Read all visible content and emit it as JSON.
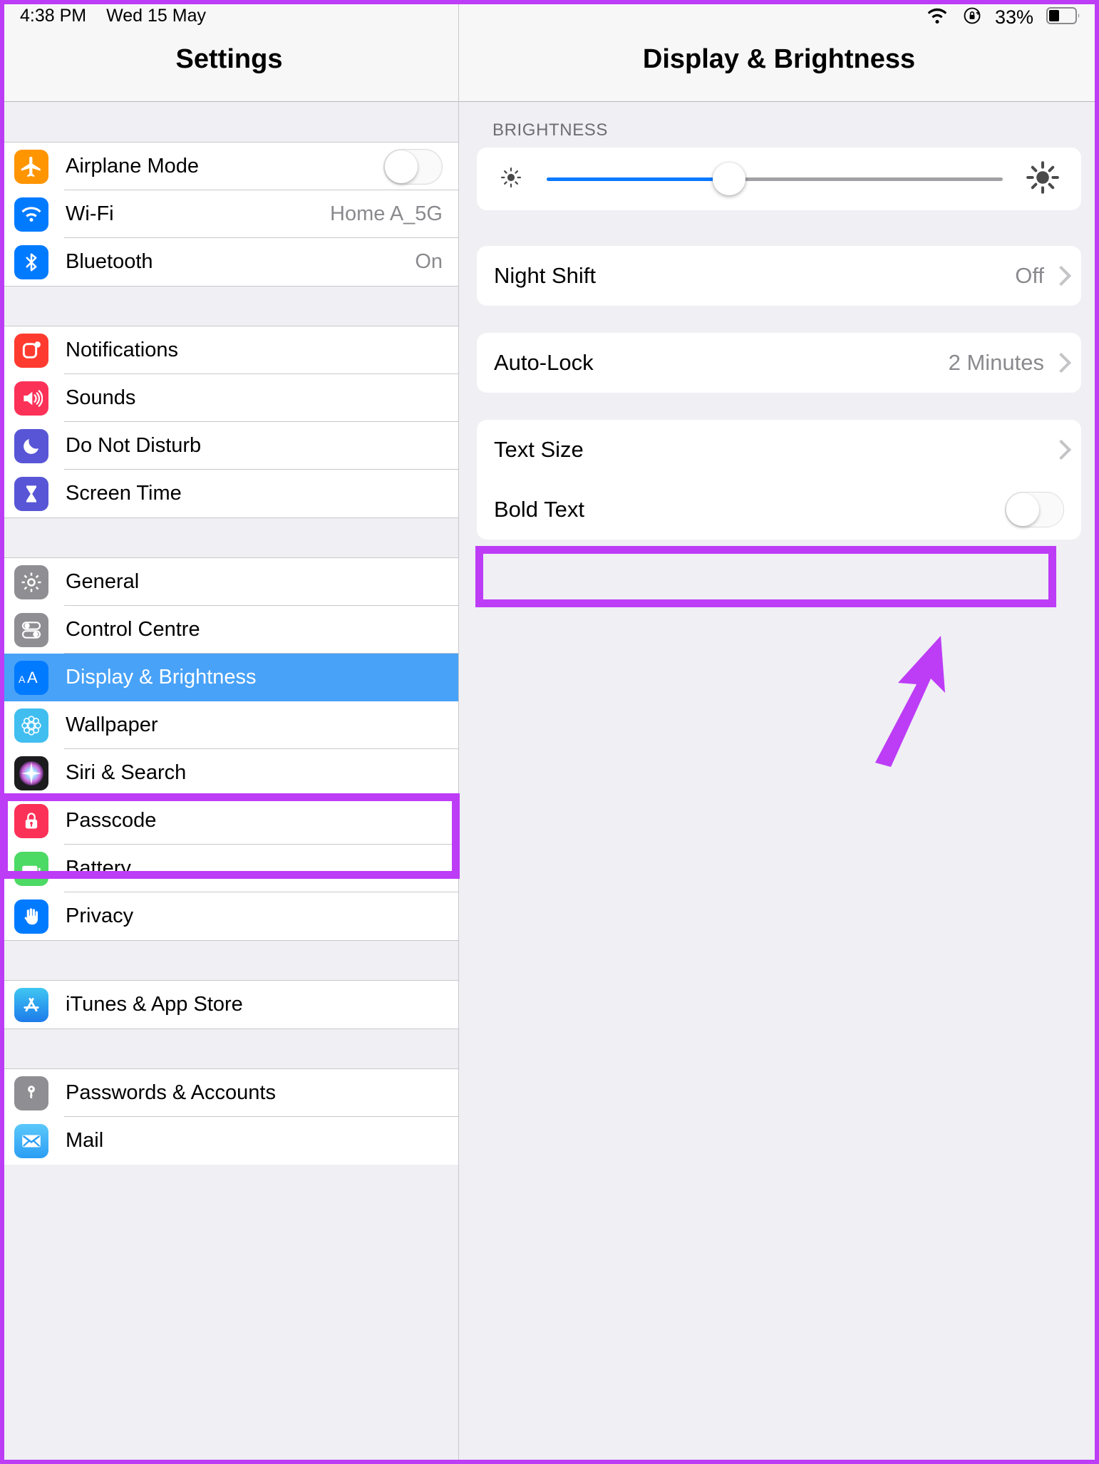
{
  "statusbar": {
    "time": "4:38 PM",
    "date": "Wed 15 May",
    "battery_percent": "33%",
    "wifi_icon": "wifi-icon",
    "rotation_lock_icon": "rotation-lock-icon",
    "battery_icon": "battery-icon"
  },
  "sidebar": {
    "title": "Settings",
    "groups": [
      {
        "rows": [
          {
            "label": "Airplane Mode",
            "icon": "airplane-icon",
            "accessory": "toggle",
            "toggle_on": false,
            "color": "#FF9500"
          },
          {
            "label": "Wi-Fi",
            "icon": "wifi-icon",
            "accessory": "value",
            "value": "Home A_5G",
            "color": "#007AFF"
          },
          {
            "label": "Bluetooth",
            "icon": "bluetooth-icon",
            "accessory": "value",
            "value": "On",
            "color": "#007AFF"
          }
        ]
      },
      {
        "rows": [
          {
            "label": "Notifications",
            "icon": "notifications-icon",
            "accessory": "none",
            "color": "#FF3B30"
          },
          {
            "label": "Sounds",
            "icon": "sounds-icon",
            "accessory": "none",
            "color": "#FC3158"
          },
          {
            "label": "Do Not Disturb",
            "icon": "moon-icon",
            "accessory": "none",
            "color": "#5856D6"
          },
          {
            "label": "Screen Time",
            "icon": "hourglass-icon",
            "accessory": "none",
            "color": "#5856D6"
          }
        ]
      },
      {
        "rows": [
          {
            "label": "General",
            "icon": "gear-icon",
            "accessory": "none",
            "color": "#8E8E93"
          },
          {
            "label": "Control Centre",
            "icon": "control-centre-icon",
            "accessory": "none",
            "color": "#8E8E93"
          },
          {
            "label": "Display & Brightness",
            "icon": "text-size-icon",
            "accessory": "none",
            "color": "#007AFF",
            "selected": true
          },
          {
            "label": "Wallpaper",
            "icon": "wallpaper-icon",
            "accessory": "none",
            "color": "#41BEF0"
          },
          {
            "label": "Siri & Search",
            "icon": "siri-icon",
            "accessory": "none",
            "color": "#1C1C1E"
          },
          {
            "label": "Passcode",
            "icon": "lock-icon",
            "accessory": "none",
            "color": "#FC3158"
          },
          {
            "label": "Battery",
            "icon": "battery-icon",
            "accessory": "none",
            "color": "#4CD964"
          },
          {
            "label": "Privacy",
            "icon": "hand-icon",
            "accessory": "none",
            "color": "#007AFF"
          }
        ]
      },
      {
        "rows": [
          {
            "label": "iTunes & App Store",
            "icon": "app-store-icon",
            "accessory": "none",
            "color": "#2EB2F0"
          }
        ]
      },
      {
        "rows": [
          {
            "label": "Passwords & Accounts",
            "icon": "key-icon",
            "accessory": "none",
            "color": "#8E8E93"
          },
          {
            "label": "Mail",
            "icon": "mail-icon",
            "accessory": "none",
            "color": "#2C9EF4"
          }
        ]
      }
    ]
  },
  "content": {
    "title": "Display & Brightness",
    "brightness": {
      "section_label": "BRIGHTNESS",
      "slider_percent": 40,
      "low_icon": "sun-low-icon",
      "high_icon": "sun-high-icon"
    },
    "rows": {
      "night_shift": {
        "label": "Night Shift",
        "value": "Off",
        "chevron_icon": "chevron-right-icon"
      },
      "auto_lock": {
        "label": "Auto-Lock",
        "value": "2 Minutes",
        "chevron_icon": "chevron-right-icon"
      },
      "text_size": {
        "label": "Text Size",
        "chevron_icon": "chevron-right-icon"
      },
      "bold_text": {
        "label": "Bold Text",
        "toggle_on": false
      }
    }
  },
  "annotations": {
    "highlight_color": "#BD3CF6",
    "boxes": [
      "display-brightness-sidebar-item",
      "text-size-row"
    ],
    "arrow": "arrow-pointing-to-bold-text-toggle"
  }
}
